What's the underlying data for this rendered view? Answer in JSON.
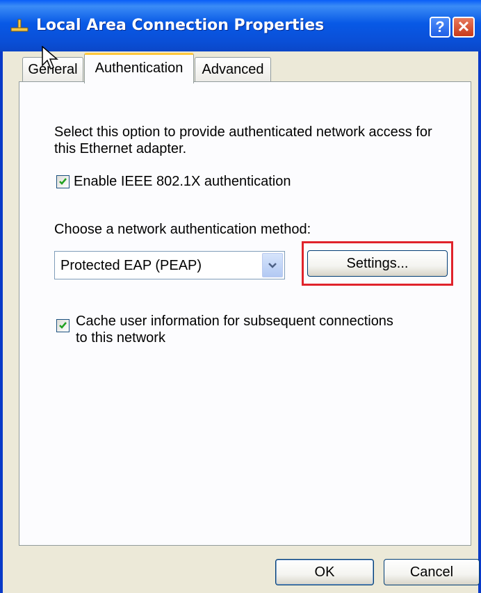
{
  "window": {
    "title": "Local Area Connection Properties",
    "help_button": "?",
    "close_button": "✕"
  },
  "tabs": [
    {
      "label": "General",
      "active": false
    },
    {
      "label": "Authentication",
      "active": true
    },
    {
      "label": "Advanced",
      "active": false
    }
  ],
  "authentication": {
    "description": "Select this option to provide authenticated network access for this Ethernet adapter.",
    "enable_8021x": {
      "label": "Enable IEEE 802.1X authentication",
      "checked": true
    },
    "method_prompt": "Choose a network authentication method:",
    "method_select": {
      "value": "Protected EAP (PEAP)"
    },
    "settings_button": "Settings...",
    "cache_user_info": {
      "label_line1": "Cache user information for subsequent connections",
      "label_line2": "to this network",
      "checked": true
    }
  },
  "footer": {
    "ok_label": "OK",
    "cancel_label": "Cancel"
  },
  "colors": {
    "titlebar": "#0a5ef8",
    "highlight_border": "#e0232b",
    "active_tab_accent": "#ffc83c",
    "checkmark": "#21a121"
  }
}
